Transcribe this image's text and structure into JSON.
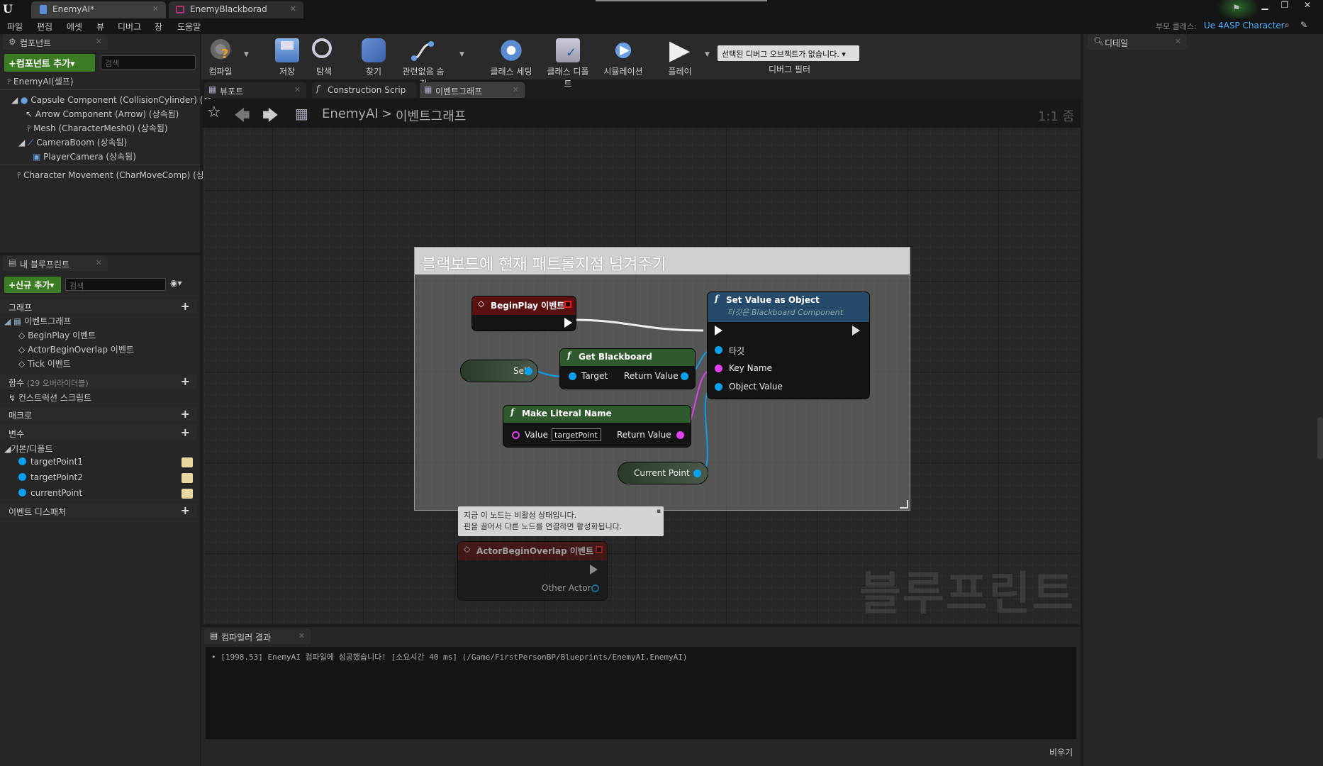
{
  "window_tabs": [
    {
      "label": "EnemyAI*"
    },
    {
      "label": "EnemyBlackborad"
    }
  ],
  "menu": [
    "파일",
    "편집",
    "에셋",
    "뷰",
    "디버그",
    "창",
    "도움말"
  ],
  "parent_class": {
    "label": "부모 클래스:",
    "value": "Ue 4ASP Character"
  },
  "components_panel": {
    "tab": "컴포넌트",
    "add_button": "+컴포넌트 추가▾",
    "search_placeholder": "검색",
    "root": "EnemyAI(셀프)",
    "items": [
      "Capsule Component (CollisionCylinder) (상",
      "Arrow Component (Arrow) (상속됨)",
      "Mesh (CharacterMesh0) (상속됨)",
      "CameraBoom (상속됨)",
      "PlayerCamera (상속됨)",
      "Character Movement (CharMoveComp) (상"
    ]
  },
  "my_blueprint": {
    "tab": "내 블루프린트",
    "add_button": "+신규 추가▾",
    "search_placeholder": "검색",
    "graph_header": "그래프",
    "event_graph": "이벤트그래프",
    "events": [
      "BeginPlay 이벤트",
      "ActorBeginOverlap 이벤트",
      "Tick 이벤트"
    ],
    "functions_header": "함수",
    "functions_override": "(29 오버라이더블)",
    "construction_script": "컨스트럭션 스크립트",
    "macros_header": "매크로",
    "variables_header": "변수",
    "variables_category": "기본/디폴트",
    "variables": [
      "targetPoint1",
      "targetPoint2",
      "currentPoint"
    ],
    "dispatchers_header": "이벤트 디스패처"
  },
  "toolbar": [
    {
      "label": "컴파일",
      "icon": "compile-icon"
    },
    {
      "label": "저장",
      "icon": "save-icon"
    },
    {
      "label": "탐색",
      "icon": "browse-icon"
    },
    {
      "label": "찾기",
      "icon": "find-icon"
    },
    {
      "label": "관련없음 숨김",
      "icon": "hide-unrelated-icon"
    },
    {
      "label": "클래스 세팅",
      "icon": "class-settings-icon"
    },
    {
      "label": "클래스 디폴트",
      "icon": "class-defaults-icon"
    },
    {
      "label": "시뮬레이션",
      "icon": "simulation-icon"
    },
    {
      "label": "플레이",
      "icon": "play-icon"
    }
  ],
  "debug": {
    "select": "선택된 디버그 오브젝트가 없습니다.",
    "label": "디버그 필터"
  },
  "editor_tabs": [
    "뷰포트",
    "Construction Scrip",
    "이벤트그래프"
  ],
  "breadcrumb": {
    "root": "EnemyAI",
    "sep": ">",
    "current": "이벤트그래프",
    "zoom": "1:1 줌"
  },
  "comment_box": {
    "title": "블랙보드에 현재 패트롤지점 넘겨주기"
  },
  "nodes": {
    "beginplay": {
      "title": "BeginPlay 이벤트"
    },
    "self": {
      "label": "Self"
    },
    "get_blackboard": {
      "title": "Get Blackboard",
      "target": "Target",
      "ret": "Return Value"
    },
    "set_value": {
      "title": "Set Value as Object",
      "subtitle": "타깃은 Blackboard Component",
      "target": "타깃",
      "key": "Key Name",
      "obj": "Object Value"
    },
    "make_literal": {
      "title": "Make Literal Name",
      "value_label": "Value",
      "value": "targetPoint",
      "ret": "Return Value"
    },
    "current_point": {
      "label": "Current Point"
    },
    "overlap": {
      "title": "ActorBeginOverlap 이벤트",
      "other": "Other Actor"
    }
  },
  "tooltip": {
    "line1": "지금 이 노드는 비활성 상태입니다.",
    "line2": "핀을 끌어서 다른 노드를 연결하면 활성화됩니다."
  },
  "watermark": "블루프린트",
  "details_tab": "디테일",
  "compiler": {
    "tab": "컴파일러 결과",
    "message": "• [1998.53] EnemyAI 컴파일에 성공했습니다! [소요시간 40 ms] (/Game/FirstPersonBP/Blueprints/EnemyAI.EnemyAI)",
    "clear": "비우기"
  }
}
